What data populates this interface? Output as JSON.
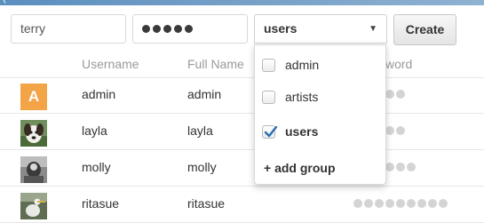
{
  "header": {
    "title_fragment": "("
  },
  "form": {
    "username_value": "terry",
    "password_dot_count": 5,
    "group_select": {
      "selected": "users",
      "arrow": "▼"
    },
    "create_label": "Create"
  },
  "table": {
    "columns": [
      "Username",
      "Full Name",
      "Password"
    ],
    "header_visible": {
      "username": "Username",
      "full_name": "Full Name",
      "password_tail": "word"
    },
    "rows": [
      {
        "avatar_type": "letter",
        "avatar_letter": "A",
        "avatar_color": "#f2a447",
        "username": "admin",
        "full_name": "admin",
        "password_dots": 5
      },
      {
        "avatar_type": "photo",
        "avatar_icon": "dog-photo-avatar",
        "username": "layla",
        "full_name": "layla",
        "password_dots": 5
      },
      {
        "avatar_type": "photo",
        "avatar_icon": "bw-photo-avatar",
        "username": "molly",
        "full_name": "molly",
        "password_dots": 6
      },
      {
        "avatar_type": "photo",
        "avatar_icon": "bird-photo-avatar",
        "username": "ritasue",
        "full_name": "ritasue",
        "password_dots": 9
      }
    ]
  },
  "dropdown": {
    "options": [
      {
        "label": "admin",
        "checked": false
      },
      {
        "label": "artists",
        "checked": false
      },
      {
        "label": "users",
        "checked": true
      }
    ],
    "add_group_label": "+ add group"
  },
  "colors": {
    "accent_check": "#2a6fb0",
    "topbar": "#6e9ac4",
    "avatar_admin": "#f2a447"
  }
}
